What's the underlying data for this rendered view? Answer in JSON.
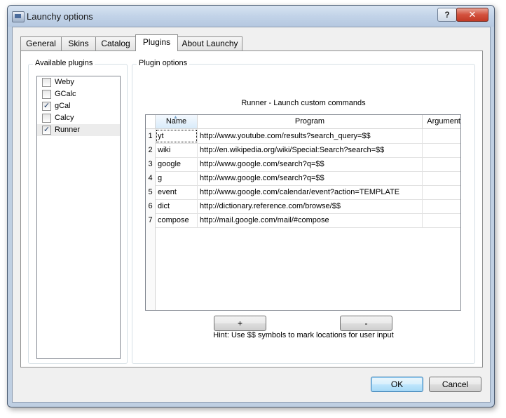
{
  "window": {
    "title": "Launchy options",
    "help_label": "?",
    "close_label": "✕"
  },
  "tabs": [
    {
      "label": "General"
    },
    {
      "label": "Skins"
    },
    {
      "label": "Catalog"
    },
    {
      "label": "Plugins",
      "active": true
    },
    {
      "label": "About Launchy"
    }
  ],
  "available_plugins": {
    "title": "Available plugins",
    "items": [
      {
        "label": "Weby",
        "checked": false
      },
      {
        "label": "GCalc",
        "checked": false
      },
      {
        "label": "gCal",
        "checked": true
      },
      {
        "label": "Calcy",
        "checked": false
      },
      {
        "label": "Runner",
        "checked": true,
        "selected": true
      }
    ]
  },
  "plugin_options": {
    "title": "Plugin options",
    "subtitle": "Runner - Launch custom commands",
    "columns": [
      "Name",
      "Program",
      "Argument"
    ],
    "rows": [
      {
        "num": "1",
        "name": "yt",
        "program": "http://www.youtube.com/results?search_query=$$",
        "argument": ""
      },
      {
        "num": "2",
        "name": "wiki",
        "program": "http://en.wikipedia.org/wiki/Special:Search?search=$$",
        "argument": ""
      },
      {
        "num": "3",
        "name": "google",
        "program": "http://www.google.com/search?q=$$",
        "argument": ""
      },
      {
        "num": "4",
        "name": "g",
        "program": "http://www.google.com/search?q=$$",
        "argument": ""
      },
      {
        "num": "5",
        "name": "event",
        "program": "http://www.google.com/calendar/event?action=TEMPLATE",
        "argument": ""
      },
      {
        "num": "6",
        "name": "dict",
        "program": "http://dictionary.reference.com/browse/$$",
        "argument": ""
      },
      {
        "num": "7",
        "name": "compose",
        "program": "http://mail.google.com/mail/#compose",
        "argument": ""
      }
    ],
    "add_label": "+",
    "remove_label": "-",
    "hint": "Hint: Use $$ symbols to mark locations for user input"
  },
  "footer": {
    "ok_label": "OK",
    "cancel_label": "Cancel"
  }
}
